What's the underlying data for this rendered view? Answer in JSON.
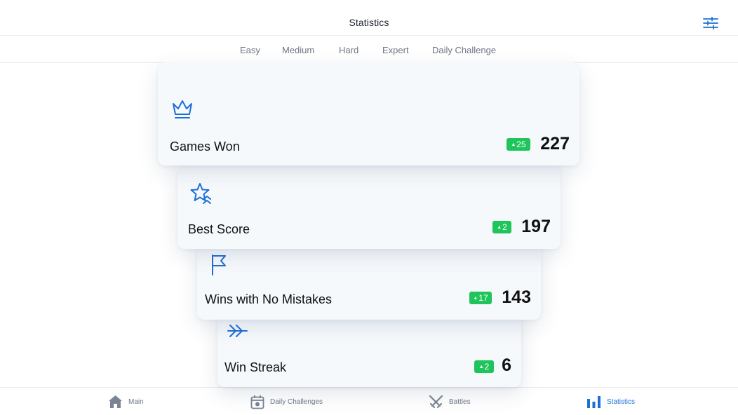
{
  "header": {
    "title": "Statistics",
    "settings_icon": "sliders-icon"
  },
  "tabs": [
    {
      "label": "Easy",
      "active": false
    },
    {
      "label": "Medium",
      "active": false
    },
    {
      "label": "Hard",
      "active": false
    },
    {
      "label": "Expert",
      "active": false
    },
    {
      "label": "Daily Challenge",
      "active": false
    }
  ],
  "stats": [
    {
      "icon": "crown-icon",
      "label": "Games Won",
      "delta": "25",
      "value": "227"
    },
    {
      "icon": "star-chevrons-icon",
      "label": "Best Score",
      "delta": "2",
      "value": "197"
    },
    {
      "icon": "flag-icon",
      "label": "Wins with No Mistakes",
      "delta": "17",
      "value": "143"
    },
    {
      "icon": "double-arrow-icon",
      "label": "Win Streak",
      "delta": "2",
      "value": "6"
    }
  ],
  "bottom_nav": [
    {
      "icon": "home-icon",
      "label": "Main",
      "active": false
    },
    {
      "icon": "calendar-icon",
      "label": "Daily Challenges",
      "active": false
    },
    {
      "icon": "crossed-swords-icon",
      "label": "Battles",
      "active": false
    },
    {
      "icon": "bar-chart-icon",
      "label": "Statistics",
      "active": true
    }
  ],
  "colors": {
    "accent": "#1d6fd8",
    "badge": "#1fc45a",
    "card_background": "#f6f9fc",
    "muted_text": "#6e7685"
  }
}
